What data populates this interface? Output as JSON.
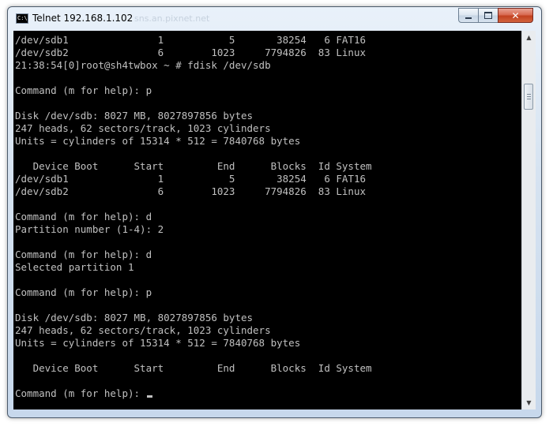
{
  "window": {
    "title": "Telnet 192.168.1.102",
    "ghost_text": "sns.an.pixnet.net",
    "icon_text": "C:\\",
    "controls": {
      "minimize": "minimize",
      "maximize": "maximize",
      "close": "close"
    }
  },
  "terminal": {
    "lines": [
      "/dev/sdb1               1           5       38254   6 FAT16",
      "/dev/sdb2               6        1023     7794826  83 Linux",
      "21:38:54[0]root@sh4twbox ~ # fdisk /dev/sdb",
      "",
      "Command (m for help): p",
      "",
      "Disk /dev/sdb: 8027 MB, 8027897856 bytes",
      "247 heads, 62 sectors/track, 1023 cylinders",
      "Units = cylinders of 15314 * 512 = 7840768 bytes",
      "",
      "   Device Boot      Start         End      Blocks  Id System",
      "/dev/sdb1               1           5       38254   6 FAT16",
      "/dev/sdb2               6        1023     7794826  83 Linux",
      "",
      "Command (m for help): d",
      "Partition number (1-4): 2",
      "",
      "Command (m for help): d",
      "Selected partition 1",
      "",
      "Command (m for help): p",
      "",
      "Disk /dev/sdb: 8027 MB, 8027897856 bytes",
      "247 heads, 62 sectors/track, 1023 cylinders",
      "Units = cylinders of 15314 * 512 = 7840768 bytes",
      "",
      "   Device Boot      Start         End      Blocks  Id System",
      "",
      "Command (m for help): "
    ]
  },
  "colors": {
    "terminal_bg": "#000000",
    "terminal_fg": "#c0c0c0",
    "close_button": "#c2411f"
  }
}
